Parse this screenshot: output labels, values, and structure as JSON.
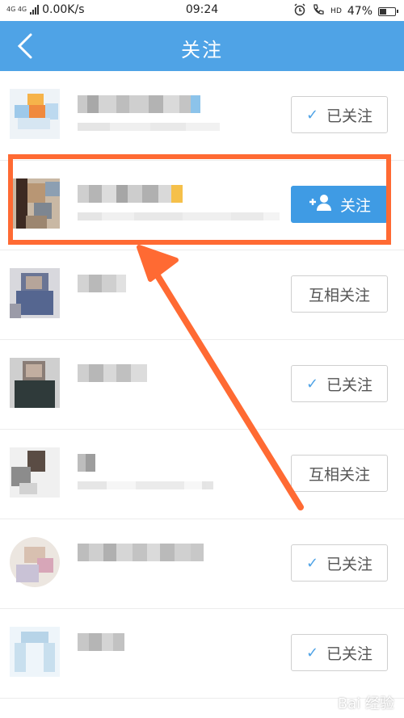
{
  "status_bar": {
    "network": "4G 4G",
    "speed": "0.00K/s",
    "time": "09:24",
    "hd": "HD",
    "battery": "47%",
    "battery_level": 0.47
  },
  "header": {
    "title": "关注"
  },
  "follow_list": {
    "rows": [
      {
        "button": "已关注",
        "state": "followed"
      },
      {
        "button": "关注",
        "state": "follow"
      },
      {
        "button": "互相关注",
        "state": "mutual"
      },
      {
        "button": "已关注",
        "state": "followed"
      },
      {
        "button": "互相关注",
        "state": "mutual"
      },
      {
        "button": "已关注",
        "state": "followed"
      },
      {
        "button": "已关注",
        "state": "followed"
      }
    ]
  },
  "icons": {
    "back": "chevron-left-icon",
    "check": "checkmark-icon",
    "add_user": "add-user-icon",
    "alarm": "alarm-icon",
    "call": "call-icon"
  },
  "colors": {
    "header": "#4fa3e6",
    "primary_button": "#3f9be4",
    "annotation": "#ff6a33"
  },
  "watermark": "Bai 经验"
}
